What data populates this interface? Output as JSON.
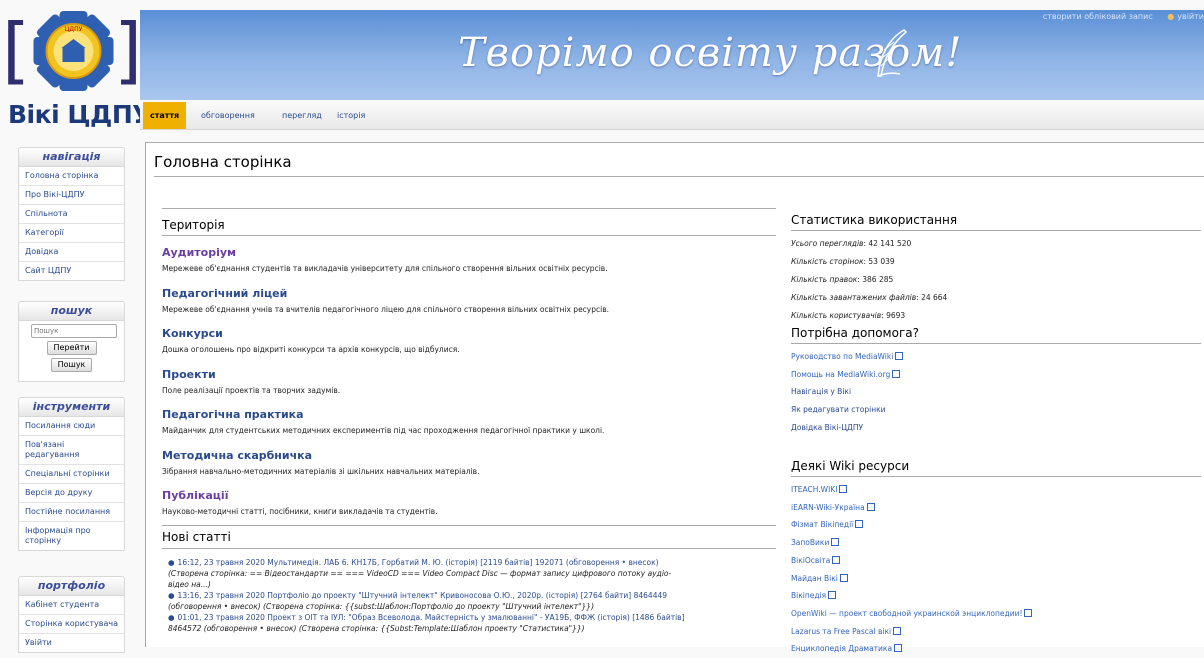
{
  "header": {
    "personal": [
      "створити обліковий запис",
      "увійти"
    ],
    "slogan": "Творімо освіту разом!",
    "site_title": "Вікі ЦДПУ",
    "emblem_text": "ЦДПУ"
  },
  "tabs": [
    {
      "label": "стаття",
      "selected": true
    },
    {
      "label": "обговорення"
    },
    {
      "label": "перегляд"
    },
    {
      "label": "історія"
    }
  ],
  "sidebar": {
    "navigation": {
      "title": "навігація",
      "items": [
        "Головна сторінка",
        "Про Вікі-ЦДПУ",
        "Спільнота",
        "Категорії",
        "Довідка",
        "Сайт ЦДПУ"
      ]
    },
    "search": {
      "title": "пошук",
      "placeholder": "Пошук",
      "go_label": "Перейти",
      "search_label": "Пошук"
    },
    "tools": {
      "title": "інструменти",
      "items": [
        "Посилання сюди",
        "Пов'язані редагування",
        "Спеціальні сторінки",
        "Версія до друку",
        "Постійне посилання",
        "Інформація про сторінку"
      ]
    },
    "portfolio": {
      "title": "портфоліо",
      "items": [
        "Кабінет студента",
        "Сторінка користувача",
        "Увійти"
      ]
    }
  },
  "content": {
    "page_title": "Головна сторінка",
    "territory": {
      "heading": "Територія",
      "sections": [
        {
          "title": "Аудиторіум",
          "desc": "Мережеве об'єднання студентів та викладачів університету для спільного створення вільних освітніх ресурсів.",
          "visited": true
        },
        {
          "title": "Педагогічний ліцей",
          "desc": "Мережеве об'єднання учнів та вчителів педагогічного ліцею для спільного створення вільних освітніх ресурсів."
        },
        {
          "title": "Конкурси",
          "desc": "Дошка оголошень про відкриті конкурси та архів конкурсів, що відбулися."
        },
        {
          "title": "Проекти",
          "desc": "Поле реалізації проектів та творчих задумів."
        },
        {
          "title": "Педагогічна практика",
          "desc": "Майданчик для студентських методичних експериментів під час проходження педагогічної практики у школі."
        },
        {
          "title": "Методична скарбничка",
          "desc": "Зібрання навчально-методичних матеріалів зі шкільних навчальних матеріалів."
        },
        {
          "title": "Публікації",
          "desc": "Науково-методичні статті, посібники, книги викладачів та студентів.",
          "visited": true
        }
      ]
    },
    "new_articles": {
      "heading": "Нові статті",
      "items": [
        {
          "line1": "16:12, 23 травня 2020 Мультимедія. ЛАБ 6. КН17Б, Горбатий М. Ю. (історія) [2119 байтів] 192071 (обговорення • внесок)",
          "line2": "(Створена сторінка: == Відеостандарти == === VideoCD === Video Compact Disc — формат запису цифрового потоку аудіо-",
          "line3": "відео на...)"
        },
        {
          "line1": "13:16, 23 травня 2020 Портфоліо до проекту \"Штучний інтелект\" Кривоносова О.Ю., 2020р. (історія) [2764 байти] 8464449",
          "line2": "(обговорення • внесок) (Створена сторінка: {{subst:Шаблон:Портфоліо до проекту \"Штучний інтелект\"}})"
        },
        {
          "line1": "01:01, 23 травня 2020 Проект з ОІТ та ІУЛ: \"Образ Всеволода. Майстерність у змалюванні\" - УА19Б, ФФЖ (історія) [1486 байтів]",
          "line2": "8464572 (обговорення • внесок) (Створена сторінка: {{Subst:Template:Шаблон проекту \"Статистика\"}})"
        }
      ]
    },
    "stats": {
      "heading": "Статистика використання",
      "rows": [
        {
          "label": "Усього переглядів",
          "value": "42 141 520"
        },
        {
          "label": "Кількість сторінок",
          "value": "53 039"
        },
        {
          "label": "Кількість правок",
          "value": "386 285"
        },
        {
          "label": "Кількість завантажених файлів",
          "value": "24 664"
        },
        {
          "label": "Кількість користувачів",
          "value": "9693"
        }
      ]
    },
    "help": {
      "heading": "Потрібна допомога?",
      "links": [
        {
          "label": "Руководство по MediaWiki",
          "external": true
        },
        {
          "label": "Помощь на MediaWiki.org",
          "external": true
        },
        {
          "label": "Навігація у Вікі",
          "external": false
        },
        {
          "label": "Як редагувати сторінки",
          "external": false
        },
        {
          "label": "Довідка Вікі-ЦДПУ",
          "external": false
        }
      ]
    },
    "resources": {
      "heading": "Деякі Wiki ресурси",
      "links": [
        "ITEACH.WIKI",
        "iEARN-Wiki-Україна",
        "Фізмат Вікіпедії",
        "ЗапоВики",
        "ВікіОсвіта",
        "Майдан Вікі",
        "Вікіпедія",
        "OpenWiki — проект свободной украинской энциклопедии!",
        "Lazarus та Free Pascal вікі",
        "Енциклопедія Драматика"
      ]
    }
  },
  "colors": {
    "link": "#2a4b8d",
    "visited": "#6b3fa0",
    "selected_tab": "#f0b000",
    "banner": "#5a8fd6"
  }
}
